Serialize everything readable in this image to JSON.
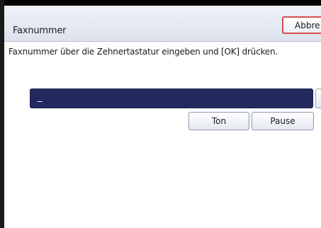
{
  "dialog": {
    "title": "Faxnummer",
    "cancel_label": "Abbre",
    "instruction": "Faxnummer über die Zehnertastatur eingeben und [OK] drücken.",
    "input_value": "_"
  },
  "keys": {
    "ton_label": "Ton",
    "pause_label": "Pause"
  },
  "colors": {
    "input_background": "#23295c",
    "cancel_border": "#d65050"
  }
}
